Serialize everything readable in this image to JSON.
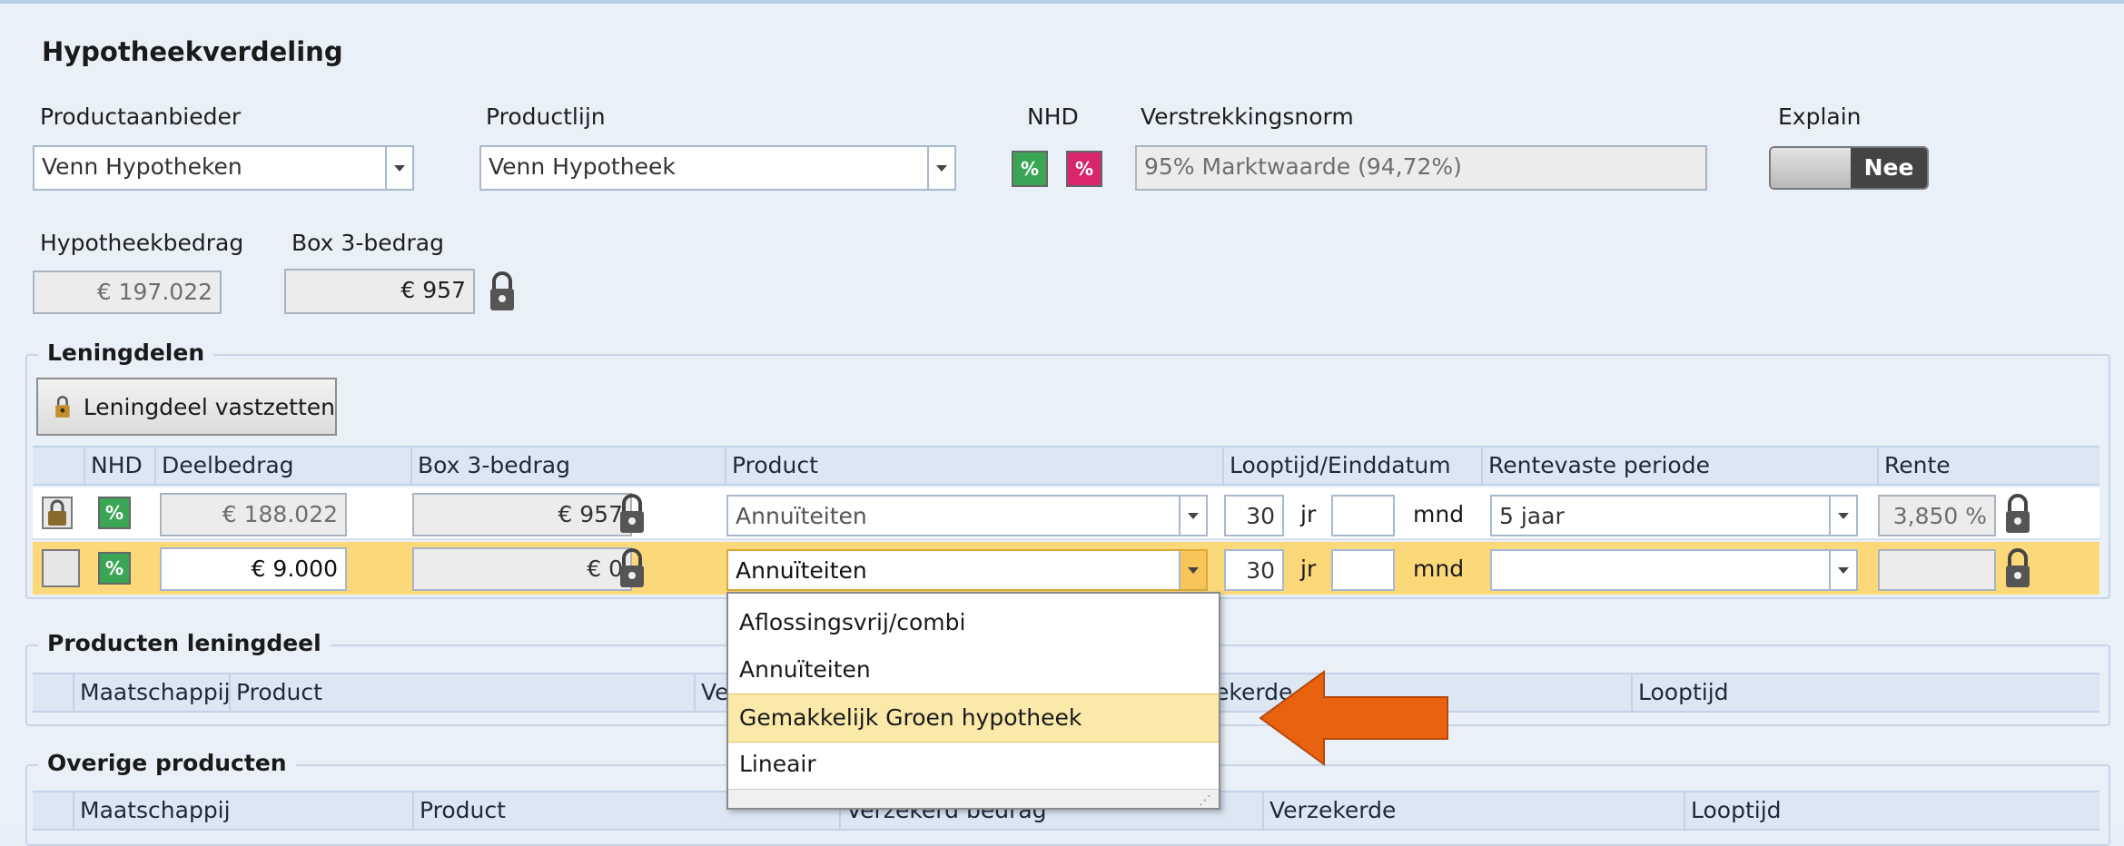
{
  "title": "Hypotheekverdeling",
  "labels": {
    "productaanbieder": "Productaanbieder",
    "productlijn": "Productlijn",
    "nhd": "NHD",
    "verstrekkingsnorm": "Verstrekkingsnorm",
    "explain": "Explain",
    "hypotheekbedrag": "Hypotheekbedrag",
    "box3": "Box 3-bedrag"
  },
  "fields": {
    "productaanbieder": "Venn Hypotheken",
    "productlijn": "Venn Hypotheek",
    "verstrekkingsnorm": "95% Marktwaarde (94,72%)",
    "hypotheekbedrag": "€ 197.022",
    "box3": "€ 957"
  },
  "explain_toggle": {
    "value": "Nee"
  },
  "leningdelen": {
    "title": "Leningdelen",
    "lock_button": "Leningdeel vastzetten",
    "columns": [
      "NHD",
      "Deelbedrag",
      "Box 3-bedrag",
      "Product",
      "Looptijd/Einddatum",
      "Rentevaste periode",
      "Rente"
    ],
    "rows": [
      {
        "deelbedrag": "€ 188.022",
        "box3": "€ 957",
        "product": "Annuïteiten",
        "jr": "30",
        "mnd": "",
        "rvp": "5 jaar",
        "rente": "3,850 %"
      },
      {
        "deelbedrag": "€ 9.000",
        "box3": "€ 0",
        "product": "Annuïteiten",
        "jr": "30",
        "mnd": "",
        "rvp": "",
        "rente": ""
      }
    ],
    "unit_jr": "jr",
    "unit_mnd": "mnd"
  },
  "producten_leningdeel": {
    "title": "Producten leningdeel",
    "columns": [
      "Maatschappij",
      "Product",
      "Ve",
      "ekerde",
      "Looptijd"
    ]
  },
  "overige_producten": {
    "title": "Overige producten",
    "columns": [
      "Maatschappij",
      "Product",
      "Verzekerd bedrag",
      "Verzekerde",
      "Looptijd"
    ]
  },
  "product_dropdown": {
    "options": [
      "Aflossingsvrij/combi",
      "Annuïteiten",
      "Gemakkelijk Groen hypotheek",
      "Lineair"
    ],
    "highlighted_index": 2
  },
  "colors": {
    "accent_arrow": "#e8620f",
    "highlight_row": "#fbd97a",
    "nhd_green": "#3aa655",
    "nhd_pink": "#d8256b"
  },
  "icons": [
    "lock-icon",
    "nhd-icon",
    "chevron-down-icon",
    "arrow-left-icon"
  ]
}
